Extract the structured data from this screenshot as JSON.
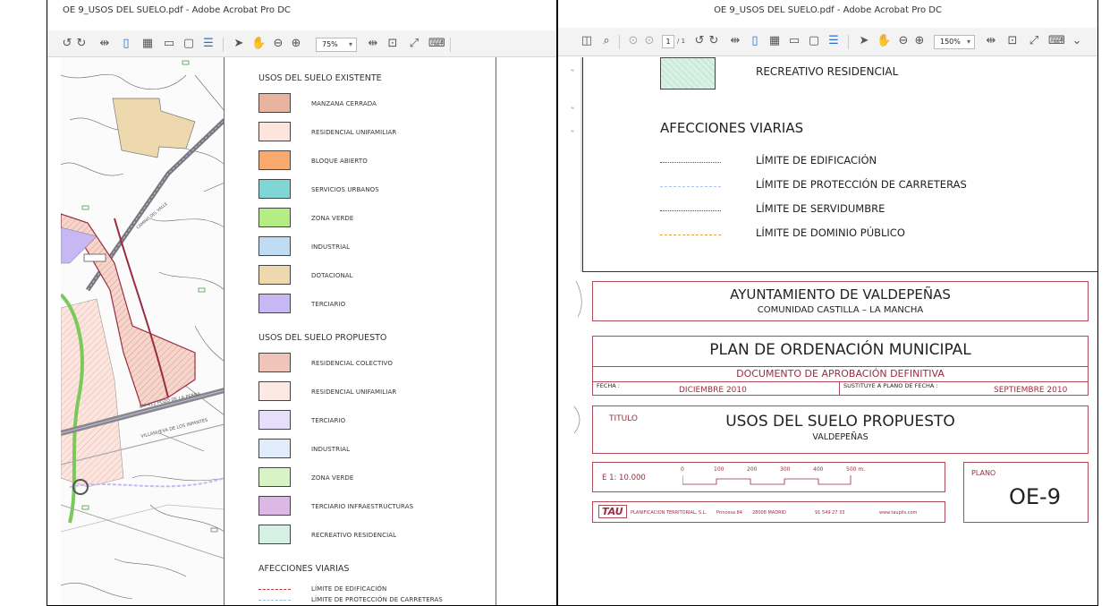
{
  "left": {
    "window_title": "OE 9_USOS DEL SUELO.pdf - Adobe Acrobat Pro DC",
    "zoom": "75%",
    "legend": {
      "heading_existing": "USOS DEL SUELO EXISTENTE",
      "existing": [
        {
          "label": "MANZANA CERRADA",
          "color": "#e8b4a0"
        },
        {
          "label": "RESIDENCIAL UNIFAMILIAR",
          "color": "#fde4dc"
        },
        {
          "label": "BLOQUE ABIERTO",
          "color": "#f8a96e"
        },
        {
          "label": "SERVICIOS URBANOS",
          "color": "#7fd6d4"
        },
        {
          "label": "ZONA VERDE",
          "color": "#b4ec86"
        },
        {
          "label": "INDUSTRIAL",
          "color": "#bfdcf4"
        },
        {
          "label": "DOTACIONAL",
          "color": "#eed8ad"
        },
        {
          "label": "TERCIARIO",
          "color": "#c7b8f3"
        }
      ],
      "heading_proposed": "USOS DEL SUELO PROPUESTO",
      "proposed": [
        {
          "label": "RESIDENCIAL COLECTIVO",
          "color": "#efc5ba"
        },
        {
          "label": "RESIDENCIAL UNIFAMILIAR",
          "color": "#fce9e4"
        },
        {
          "label": "TERCIARIO",
          "color": "#e6defa"
        },
        {
          "label": "INDUSTRIAL",
          "color": "#e0ecf9"
        },
        {
          "label": "ZONA VERDE",
          "color": "#d8f3c6"
        },
        {
          "label": "TERCIARIO INFRAESTRUCTURAS",
          "color": "#dcb8e6"
        },
        {
          "label": "RECREATIVO RESIDENCIAL",
          "color": "#d4f1e4"
        }
      ],
      "heading_affections": "AFECCIONES VIARIAS",
      "affections": [
        {
          "label": "LÍMITE DE EDIFICACIÓN",
          "color": "#b03030"
        },
        {
          "label": "LÍMITE DE PROTECCIÓN DE CARRETERAS",
          "color": "#9fb7e6"
        }
      ]
    },
    "map_labels": {
      "road1": "CM-412 POZO DE LA PERNA",
      "road2": "VILLANUEVA DE LOS INFANTES",
      "road3": "CAMINO DEL VALLE"
    }
  },
  "right": {
    "window_title": "OE 9_USOS DEL SUELO.pdf - Adobe Acrobat Pro DC",
    "page_current": "1",
    "page_total": "/ 1",
    "zoom": "150%",
    "recreativo_label": "RECREATIVO RESIDENCIAL",
    "affections_heading": "AFECCIONES VIARIAS",
    "affections": [
      {
        "label": "LÍMITE DE EDIFICACIÓN",
        "color": "#b03030",
        "style": "dashdot"
      },
      {
        "label": "LÍMITE DE PROTECCIÓN DE CARRETERAS",
        "color": "#a8c4ef",
        "style": "dashed"
      },
      {
        "label": "LÍMITE DE SERVIDUMBRE",
        "color": "#3a3ab0",
        "style": "dashdot"
      },
      {
        "label": "LÍMITE DE DOMINIO PÚBLICO",
        "color": "#e7a043",
        "style": "dashed"
      }
    ],
    "ayto_title": "AYUNTAMIENTO DE VALDEPEÑAS",
    "ayto_sub": "COMUNIDAD CASTILLA – LA MANCHA",
    "plan_title": "PLAN DE ORDENACIÓN MUNICIPAL",
    "doc_title": "DOCUMENTO  DE APROBACIÓN DEFINITIVA",
    "fecha_label": "FECHA :",
    "fecha_value": "DICIEMBRE 2010",
    "sustituye_label": "SUSTITUYE A PLANO DE FECHA :",
    "sustituye_value": "SEPTIEMBRE 2010",
    "titulo_label": "TITULO",
    "titulo_value": "USOS DEL SUELO PROPUESTO",
    "titulo_sub": "VALDEPEÑAS",
    "scale_label": "E  1: 10.000",
    "scale_ticks": [
      "0",
      "100",
      "200",
      "300",
      "400",
      "500 m."
    ],
    "plano_label": "PLANO",
    "plano_value": "OE-9",
    "footer_logo": "TAU",
    "footer_company": "PLANIFICACION TERRITORIAL, S.L.",
    "footer_address": "Princesa 84",
    "footer_city": "28008 MADRID",
    "footer_phone": "91 549 27 33",
    "footer_web": "www.tauplis.com"
  }
}
